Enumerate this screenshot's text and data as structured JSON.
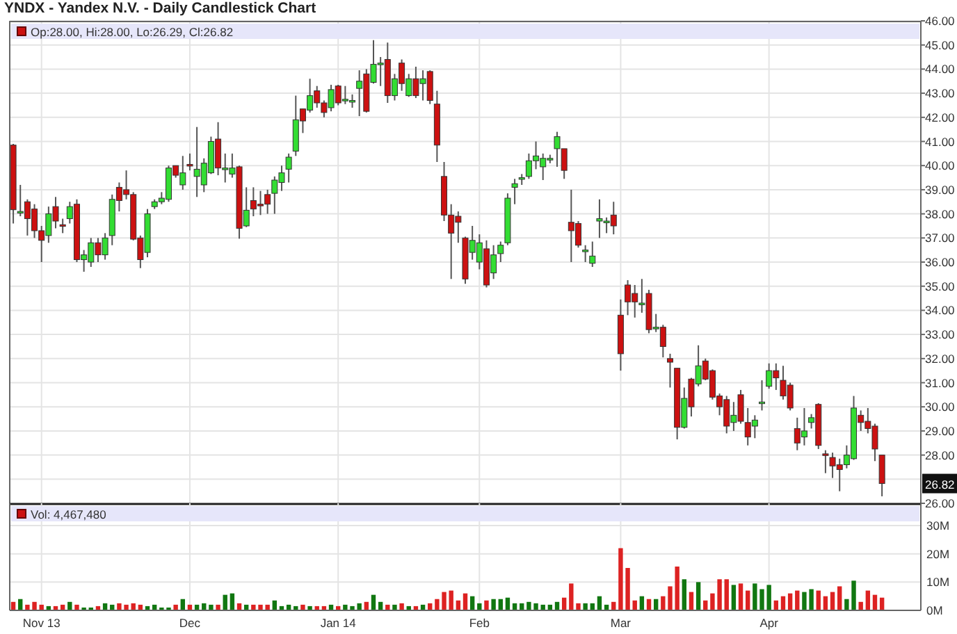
{
  "title": "YNDX - Yandex N.V. - Daily Candlestick Chart",
  "price_panel": {
    "legend": "Op:28.00, Hi:28.00, Lo:26.29, Cl:26.82",
    "last_price": "26.82",
    "chart_data": {
      "type": "candlestick",
      "grid": true,
      "ylim": [
        26,
        46
      ],
      "yticks": [
        {
          "value": 46,
          "label": "46.00"
        },
        {
          "value": 45,
          "label": "45.00"
        },
        {
          "value": 44,
          "label": "44.00"
        },
        {
          "value": 43,
          "label": "43.00"
        },
        {
          "value": 42,
          "label": "42.00"
        },
        {
          "value": 41,
          "label": "41.00"
        },
        {
          "value": 40,
          "label": "40.00"
        },
        {
          "value": 39,
          "label": "39.00"
        },
        {
          "value": 38,
          "label": "38.00"
        },
        {
          "value": 37,
          "label": "37.00"
        },
        {
          "value": 36,
          "label": "36.00"
        },
        {
          "value": 35,
          "label": "35.00"
        },
        {
          "value": 34,
          "label": "34.00"
        },
        {
          "value": 33,
          "label": "33.00"
        },
        {
          "value": 32,
          "label": "32.00"
        },
        {
          "value": 31,
          "label": "31.00"
        },
        {
          "value": 30,
          "label": "30.00"
        },
        {
          "value": 29,
          "label": "29.00"
        },
        {
          "value": 28,
          "label": "28.00"
        },
        {
          "value": 26,
          "label": "26.00"
        }
      ],
      "categories": [
        null,
        null,
        null,
        null,
        null,
        null,
        null,
        null,
        null,
        null,
        null,
        null,
        null,
        null,
        null,
        null,
        null,
        null,
        null,
        null,
        null,
        null,
        null,
        null,
        null,
        null,
        null,
        null,
        null,
        null,
        null,
        null,
        null,
        null,
        null,
        null,
        null,
        null,
        null,
        null,
        null,
        null,
        null,
        null,
        null,
        null,
        null,
        null,
        null,
        null,
        null,
        null,
        null,
        null,
        null,
        null,
        null,
        null,
        null,
        null,
        null,
        null,
        null,
        null,
        null,
        null,
        null,
        null,
        null,
        null,
        null,
        null,
        null,
        null,
        null,
        null,
        null,
        null,
        null,
        null,
        null,
        null,
        null,
        null,
        null,
        null,
        null,
        null,
        null,
        null,
        null,
        null,
        null,
        null,
        null,
        null,
        null,
        null,
        null,
        null,
        null,
        null,
        null,
        null,
        null,
        null,
        null,
        null,
        null,
        null,
        null,
        null,
        null,
        null,
        null,
        null,
        null,
        null,
        null,
        null,
        null,
        null,
        null,
        null,
        null,
        null,
        null,
        null,
        null
      ],
      "ohlc": [
        [
          40.85,
          40.9,
          37.6,
          38.17
        ],
        [
          38.1,
          39.2,
          37.9,
          38.1
        ],
        [
          38.5,
          38.6,
          37.1,
          37.8
        ],
        [
          38.2,
          38.4,
          37.0,
          37.3
        ],
        [
          37.3,
          37.5,
          36.0,
          36.9
        ],
        [
          37.1,
          38.3,
          36.8,
          38.0
        ],
        [
          38.3,
          38.7,
          37.4,
          37.7
        ],
        [
          37.55,
          37.8,
          37.2,
          37.5
        ],
        [
          37.8,
          38.5,
          37.6,
          38.3
        ],
        [
          38.4,
          38.6,
          36.0,
          36.1
        ],
        [
          36.1,
          36.5,
          35.6,
          36.3
        ],
        [
          36.0,
          37.0,
          35.8,
          36.8
        ],
        [
          36.8,
          37.0,
          36.0,
          36.3
        ],
        [
          36.3,
          37.2,
          36.1,
          37.0
        ],
        [
          37.1,
          38.8,
          36.7,
          38.6
        ],
        [
          39.1,
          39.3,
          38.1,
          38.55
        ],
        [
          39.0,
          39.8,
          38.6,
          38.8
        ],
        [
          38.8,
          38.9,
          36.9,
          36.95
        ],
        [
          37.0,
          37.1,
          35.75,
          36.1
        ],
        [
          36.4,
          38.2,
          36.2,
          38.0
        ],
        [
          38.3,
          38.6,
          38.2,
          38.5
        ],
        [
          38.5,
          38.9,
          38.4,
          38.65
        ],
        [
          38.6,
          40.0,
          38.5,
          39.9
        ],
        [
          40.0,
          40.0,
          39.5,
          39.6
        ],
        [
          39.2,
          40.4,
          39.0,
          39.7
        ],
        [
          40.05,
          40.5,
          39.8,
          40.0
        ],
        [
          39.55,
          41.6,
          38.7,
          39.85
        ],
        [
          39.2,
          40.3,
          38.9,
          40.1
        ],
        [
          39.7,
          41.2,
          39.65,
          41.0
        ],
        [
          41.1,
          41.8,
          39.6,
          39.9
        ],
        [
          39.9,
          40.5,
          39.3,
          39.9
        ],
        [
          39.65,
          40.5,
          39.5,
          39.9
        ],
        [
          39.95,
          40.0,
          36.97,
          37.4
        ],
        [
          37.5,
          39.1,
          37.45,
          38.15
        ],
        [
          38.55,
          39.1,
          37.9,
          38.2
        ],
        [
          38.4,
          38.95,
          37.95,
          38.35
        ],
        [
          38.8,
          39.0,
          38.0,
          38.4
        ],
        [
          38.85,
          39.55,
          38.0,
          39.4
        ],
        [
          39.3,
          40.0,
          38.95,
          39.7
        ],
        [
          39.85,
          40.5,
          39.3,
          40.35
        ],
        [
          40.6,
          42.9,
          40.4,
          41.9
        ],
        [
          42.35,
          42.35,
          41.35,
          41.85
        ],
        [
          42.3,
          43.6,
          42.2,
          42.9
        ],
        [
          43.1,
          43.3,
          42.4,
          42.6
        ],
        [
          42.6,
          42.7,
          42.0,
          42.2
        ],
        [
          42.4,
          43.35,
          42.25,
          43.15
        ],
        [
          43.3,
          43.35,
          42.5,
          42.6
        ],
        [
          42.75,
          43.3,
          42.55,
          42.75
        ],
        [
          42.7,
          42.95,
          42.4,
          42.7
        ],
        [
          43.2,
          43.95,
          42.05,
          43.5
        ],
        [
          43.8,
          44.0,
          42.2,
          42.25
        ],
        [
          43.45,
          45.2,
          43.4,
          44.2
        ],
        [
          44.25,
          44.5,
          43.3,
          44.25
        ],
        [
          44.4,
          45.1,
          42.6,
          42.9
        ],
        [
          42.9,
          43.8,
          42.7,
          43.6
        ],
        [
          44.25,
          44.4,
          43.1,
          43.4
        ],
        [
          42.9,
          43.8,
          42.85,
          43.6
        ],
        [
          43.6,
          44.1,
          42.8,
          42.9
        ],
        [
          43.4,
          43.95,
          42.7,
          43.6
        ],
        [
          43.9,
          43.95,
          42.55,
          42.7
        ],
        [
          42.55,
          43.1,
          40.15,
          40.85
        ],
        [
          39.55,
          40.15,
          37.7,
          37.95
        ],
        [
          37.95,
          38.4,
          35.3,
          37.2
        ],
        [
          37.9,
          38.1,
          36.8,
          37.65
        ],
        [
          37.0,
          37.05,
          35.1,
          35.3
        ],
        [
          36.4,
          37.5,
          36.1,
          36.9
        ],
        [
          36.0,
          37.15,
          35.7,
          36.8
        ],
        [
          36.55,
          36.9,
          34.95,
          35.05
        ],
        [
          35.55,
          36.7,
          35.3,
          36.3
        ],
        [
          36.35,
          36.85,
          36.0,
          36.7
        ],
        [
          36.8,
          38.85,
          36.7,
          38.65
        ],
        [
          39.1,
          39.45,
          38.4,
          39.25
        ],
        [
          39.5,
          39.65,
          39.2,
          39.5
        ],
        [
          39.55,
          40.5,
          39.45,
          40.2
        ],
        [
          40.2,
          41.0,
          39.85,
          40.4
        ],
        [
          39.95,
          40.5,
          39.4,
          40.3
        ],
        [
          40.3,
          40.45,
          40.1,
          40.3
        ],
        [
          40.7,
          41.4,
          39.95,
          41.2
        ],
        [
          40.7,
          40.7,
          39.45,
          39.8
        ],
        [
          37.65,
          39.0,
          36.0,
          37.3
        ],
        [
          37.6,
          37.7,
          36.6,
          36.7
        ],
        [
          36.5,
          36.7,
          36.0,
          36.5
        ],
        [
          35.95,
          36.85,
          35.8,
          36.25
        ],
        [
          37.7,
          38.6,
          37.0,
          37.8
        ],
        [
          37.65,
          37.85,
          37.2,
          37.7
        ],
        [
          37.95,
          38.5,
          37.15,
          37.5
        ],
        [
          33.8,
          34.45,
          31.5,
          32.2
        ],
        [
          35.05,
          35.25,
          33.8,
          34.35
        ],
        [
          34.7,
          35.05,
          33.7,
          34.35
        ],
        [
          34.3,
          35.3,
          33.9,
          34.3
        ],
        [
          34.7,
          34.85,
          33.05,
          33.2
        ],
        [
          33.25,
          33.85,
          33.1,
          33.3
        ],
        [
          33.3,
          33.4,
          32.05,
          32.5
        ],
        [
          32.0,
          32.2,
          30.8,
          31.85
        ],
        [
          31.6,
          31.6,
          28.65,
          29.15
        ],
        [
          29.15,
          30.8,
          29.1,
          30.35
        ],
        [
          31.15,
          31.2,
          29.6,
          30.0
        ],
        [
          30.95,
          32.55,
          30.85,
          31.7
        ],
        [
          31.9,
          32.0,
          31.1,
          31.15
        ],
        [
          31.5,
          31.55,
          30.3,
          30.4
        ],
        [
          30.45,
          30.55,
          29.65,
          30.0
        ],
        [
          30.3,
          30.45,
          28.9,
          29.2
        ],
        [
          29.35,
          30.2,
          29.0,
          29.65
        ],
        [
          30.5,
          30.7,
          29.3,
          29.4
        ],
        [
          29.35,
          29.95,
          28.4,
          28.75
        ],
        [
          29.2,
          29.65,
          28.7,
          29.45
        ],
        [
          30.2,
          31.1,
          29.85,
          30.2
        ],
        [
          30.85,
          31.8,
          30.75,
          31.5
        ],
        [
          31.5,
          31.8,
          30.7,
          31.2
        ],
        [
          31.1,
          31.7,
          30.3,
          30.45
        ],
        [
          30.9,
          31.0,
          29.85,
          29.95
        ],
        [
          29.1,
          29.55,
          28.2,
          28.5
        ],
        [
          28.75,
          29.95,
          28.4,
          29.0
        ],
        [
          29.35,
          29.7,
          29.1,
          29.55
        ],
        [
          30.1,
          30.15,
          28.25,
          28.4
        ],
        [
          28.05,
          28.2,
          27.25,
          28.0
        ],
        [
          27.9,
          28.1,
          27.05,
          27.55
        ],
        [
          27.6,
          27.85,
          26.5,
          27.4
        ],
        [
          27.6,
          28.4,
          27.45,
          28.0
        ],
        [
          27.85,
          30.45,
          27.8,
          29.95
        ],
        [
          29.65,
          29.85,
          29.0,
          29.35
        ],
        [
          29.4,
          29.95,
          28.9,
          29.1
        ],
        [
          29.2,
          29.3,
          27.75,
          28.25
        ],
        [
          28.0,
          28.0,
          26.29,
          26.82
        ],
        null,
        null,
        null,
        null,
        null
      ]
    }
  },
  "volume_panel": {
    "legend": "Vol: 4,467,480",
    "chart_data": {
      "type": "bar",
      "grid": true,
      "ylim": [
        0,
        30
      ],
      "yticks": [
        {
          "value": 0,
          "label": "0M"
        },
        {
          "value": 10,
          "label": "10M"
        },
        {
          "value": 20,
          "label": "20M"
        },
        {
          "value": 30,
          "label": "30M"
        }
      ],
      "categories": [
        null,
        null,
        null,
        null,
        "Nov 13",
        null,
        null,
        null,
        null,
        null,
        null,
        null,
        null,
        null,
        null,
        null,
        null,
        null,
        null,
        null,
        null,
        null,
        null,
        null,
        null,
        "Dec",
        null,
        null,
        null,
        null,
        null,
        null,
        null,
        null,
        null,
        null,
        null,
        null,
        null,
        null,
        null,
        null,
        null,
        null,
        null,
        null,
        "Jan 14",
        null,
        null,
        null,
        null,
        null,
        null,
        null,
        null,
        null,
        null,
        null,
        null,
        null,
        null,
        null,
        null,
        null,
        null,
        null,
        "Feb",
        null,
        null,
        null,
        null,
        null,
        null,
        null,
        null,
        null,
        null,
        null,
        null,
        null,
        null,
        null,
        null,
        null,
        null,
        null,
        "Mar",
        null,
        null,
        null,
        null,
        null,
        null,
        null,
        null,
        null,
        null,
        null,
        null,
        null,
        null,
        null,
        null,
        null,
        null,
        null,
        null,
        "Apr",
        null,
        null,
        null,
        null,
        null,
        null,
        null,
        null,
        null,
        null,
        null,
        null,
        null,
        null,
        null,
        null,
        null,
        null,
        null,
        null,
        null
      ],
      "values": [
        3,
        4,
        2,
        3,
        2,
        1.5,
        1.5,
        2,
        3,
        2,
        1,
        1,
        1.5,
        2.5,
        2,
        2.5,
        2,
        2.5,
        2,
        1.5,
        2,
        1,
        1,
        2,
        4,
        2,
        2,
        2.5,
        2,
        2,
        5.5,
        6,
        2.5,
        2,
        2,
        2,
        2,
        3.5,
        1.5,
        2,
        1.5,
        2,
        1.5,
        1.5,
        1.5,
        2,
        1.5,
        2,
        1.5,
        2.5,
        3,
        5.5,
        3,
        2,
        2,
        2.5,
        1.5,
        1.5,
        2,
        2.5,
        4,
        6.5,
        7,
        3.5,
        6,
        5,
        2.5,
        3.5,
        4,
        4,
        4.5,
        2.5,
        2.5,
        3,
        2.5,
        2,
        2,
        3,
        4.5,
        9.5,
        2.5,
        2.5,
        2.5,
        5,
        2,
        3,
        22,
        15,
        3.5,
        5,
        4,
        4,
        5,
        8.5,
        15.5,
        11,
        6.5,
        10,
        3.5,
        6,
        11,
        11,
        9,
        9.5,
        7,
        9.5,
        7.5,
        9,
        3.5,
        5,
        6,
        7,
        6.5,
        7.5,
        7,
        5,
        6.5,
        8.5,
        4,
        10.5,
        3,
        7,
        5.5,
        4.5,
        null,
        null,
        null,
        null,
        null
      ]
    }
  }
}
